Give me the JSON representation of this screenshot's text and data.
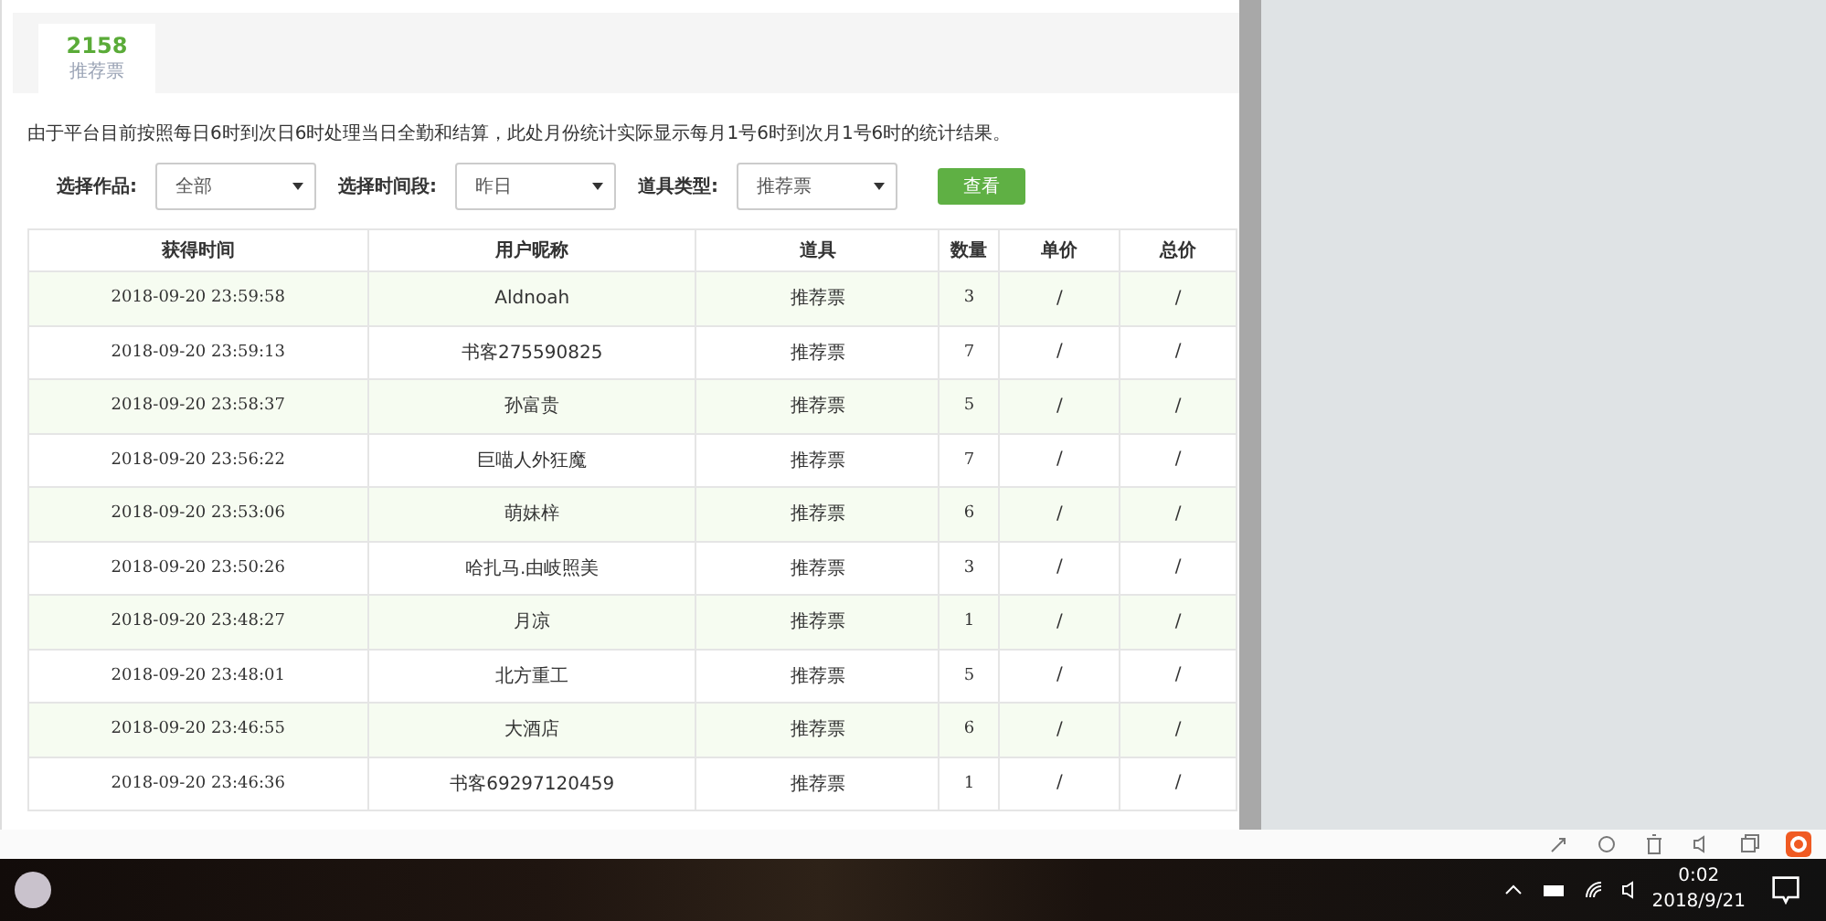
{
  "summary": {
    "value": "2158",
    "label": "推荐票"
  },
  "notice": "由于平台目前按照每日6时到次日6时处理当日全勤和结算，此处月份统计实际显示每月1号6时到次月1号6时的统计结果。",
  "filters": [
    {
      "label": "选择作品:",
      "value": "全部"
    },
    {
      "label": "选择时间段:",
      "value": "昨日"
    },
    {
      "label": "道具类型:",
      "value": "推荐票"
    }
  ],
  "query_button": "查看",
  "table": {
    "columns": [
      "获得时间",
      "用户昵称",
      "道具",
      "数量",
      "单价",
      "总价"
    ],
    "rows": [
      [
        "2018-09-20 23:59:58",
        "Aldnoah",
        "推荐票",
        "3",
        "/",
        "/"
      ],
      [
        "2018-09-20 23:59:13",
        "书客275590825",
        "推荐票",
        "7",
        "/",
        "/"
      ],
      [
        "2018-09-20 23:58:37",
        "孙富贵",
        "推荐票",
        "5",
        "/",
        "/"
      ],
      [
        "2018-09-20 23:56:22",
        "巨喵人外狂魔",
        "推荐票",
        "7",
        "/",
        "/"
      ],
      [
        "2018-09-20 23:53:06",
        "萌妹梓",
        "推荐票",
        "6",
        "/",
        "/"
      ],
      [
        "2018-09-20 23:50:26",
        "哈扎马.由岐照美",
        "推荐票",
        "3",
        "/",
        "/"
      ],
      [
        "2018-09-20 23:48:27",
        "月凉",
        "推荐票",
        "1",
        "/",
        "/"
      ],
      [
        "2018-09-20 23:48:01",
        "北方重工",
        "推荐票",
        "5",
        "/",
        "/"
      ],
      [
        "2018-09-20 23:46:55",
        "大酒店",
        "推荐票",
        "6",
        "/",
        "/"
      ],
      [
        "2018-09-20 23:46:36",
        "书客69297120459",
        "推荐票",
        "1",
        "/",
        "/"
      ]
    ]
  },
  "taskbar": {
    "time": "0:02",
    "date": "2018/9/21"
  }
}
